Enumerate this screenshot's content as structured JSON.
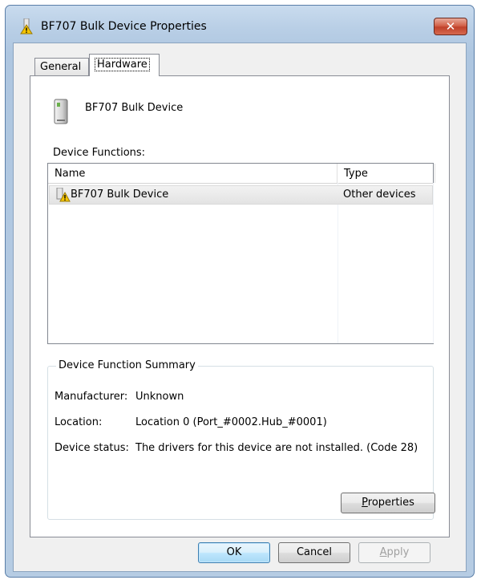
{
  "window": {
    "title": "BF707 Bulk Device Properties",
    "close_label": "✕"
  },
  "tabs": [
    {
      "label": "General",
      "selected": false
    },
    {
      "label": "Hardware",
      "selected": true
    }
  ],
  "device": {
    "name": "BF707 Bulk Device",
    "icon": "usb-device-icon"
  },
  "functions": {
    "label": "Device Functions:",
    "columns": [
      "Name",
      "Type"
    ],
    "rows": [
      {
        "name": "BF707 Bulk Device",
        "type": "Other devices",
        "icon": "warning-device-icon"
      }
    ]
  },
  "summary": {
    "title": "Device Function Summary",
    "manufacturer_label": "Manufacturer:",
    "manufacturer_value": "Unknown",
    "location_label": "Location:",
    "location_value": "Location 0 (Port_#0002.Hub_#0001)",
    "status_label": "Device status:",
    "status_value": "The drivers for this device are not installed. (Code 28)",
    "properties_button_pre": "P",
    "properties_button_rest": "roperties"
  },
  "buttons": {
    "ok": "OK",
    "cancel": "Cancel",
    "apply_pre": "A",
    "apply_rest": "pply"
  },
  "colors": {
    "accent": "#3c7fb1",
    "close": "#c0412a",
    "frame": "#aec6e0"
  }
}
